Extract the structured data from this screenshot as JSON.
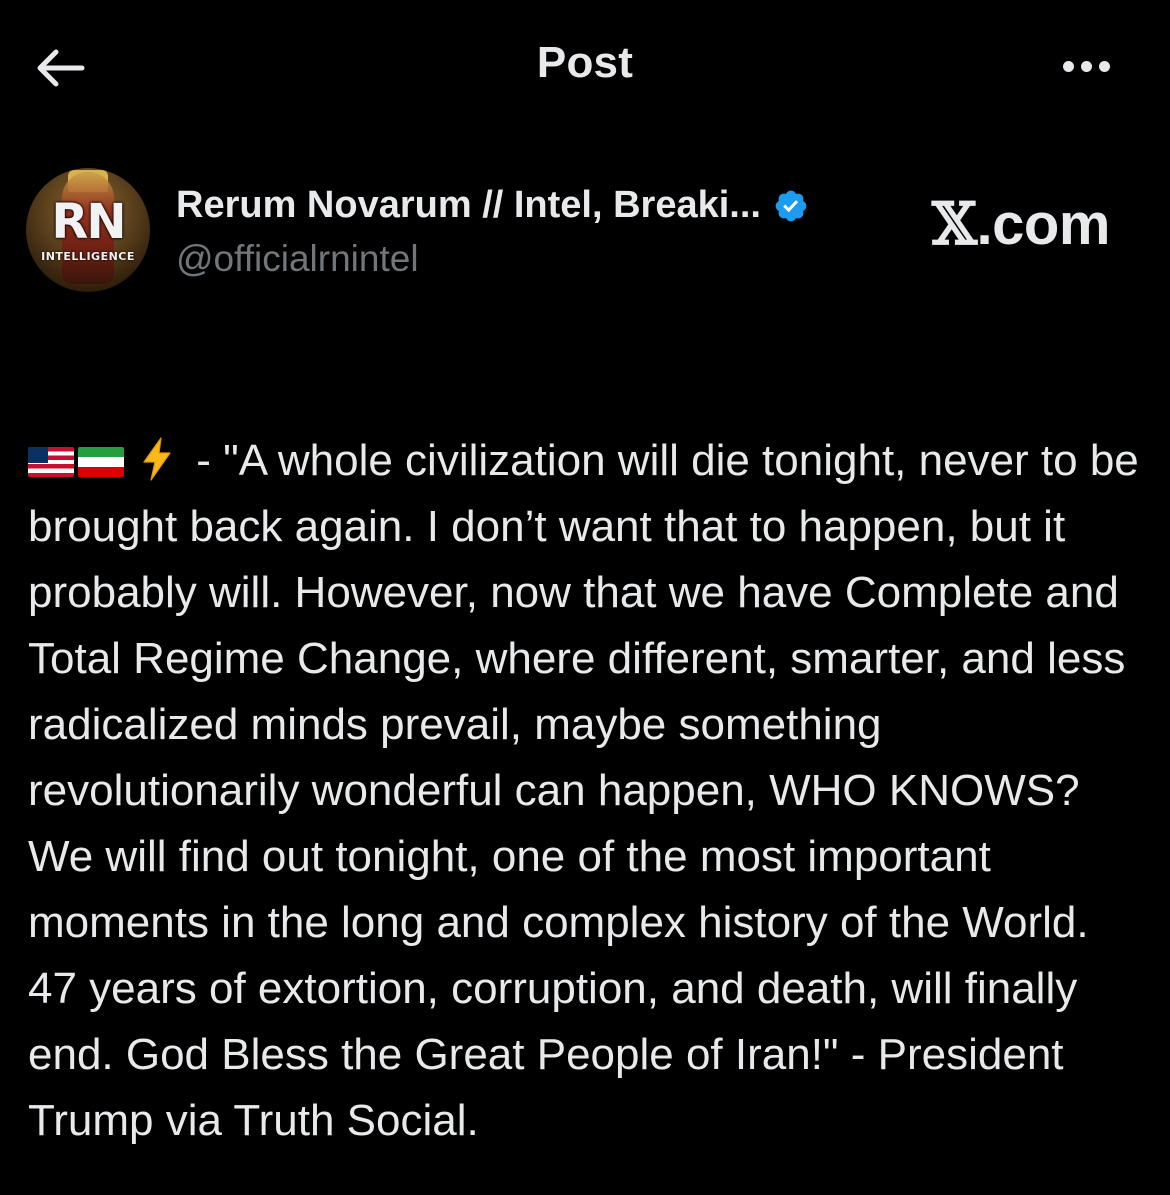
{
  "header": {
    "title": "Post"
  },
  "author": {
    "display_name": "Rerum Novarum // Intel, Breaki...",
    "handle": "@officialrnintel",
    "avatar_text": "RN",
    "avatar_subtext": "INTELLIGENCE",
    "verified_color": "#1d9bf0"
  },
  "watermark": {
    "x_glyph": "𝕏",
    "text": ".com"
  },
  "post": {
    "emoji": [
      "us-flag",
      "iran-flag",
      "lightning-bolt"
    ],
    "text": " - \"A whole civilization will die tonight, never to be brought back again. I don’t want that to happen, but it probably will. However, now that we have Complete and Total Regime Change, where different, smarter, and less radicalized minds prevail, maybe something revolutionarily wonderful can happen, WHO KNOWS? We will find out tonight, one of the most important moments in the long and complex history of the World. 47 years of extortion, corruption, and death, will finally end. God Bless the Great People of Iran!\" - President Trump via Truth Social."
  },
  "colors": {
    "background": "#000000",
    "text_primary": "#e7e9ea",
    "text_secondary": "#71767b",
    "accent": "#1d9bf0"
  }
}
